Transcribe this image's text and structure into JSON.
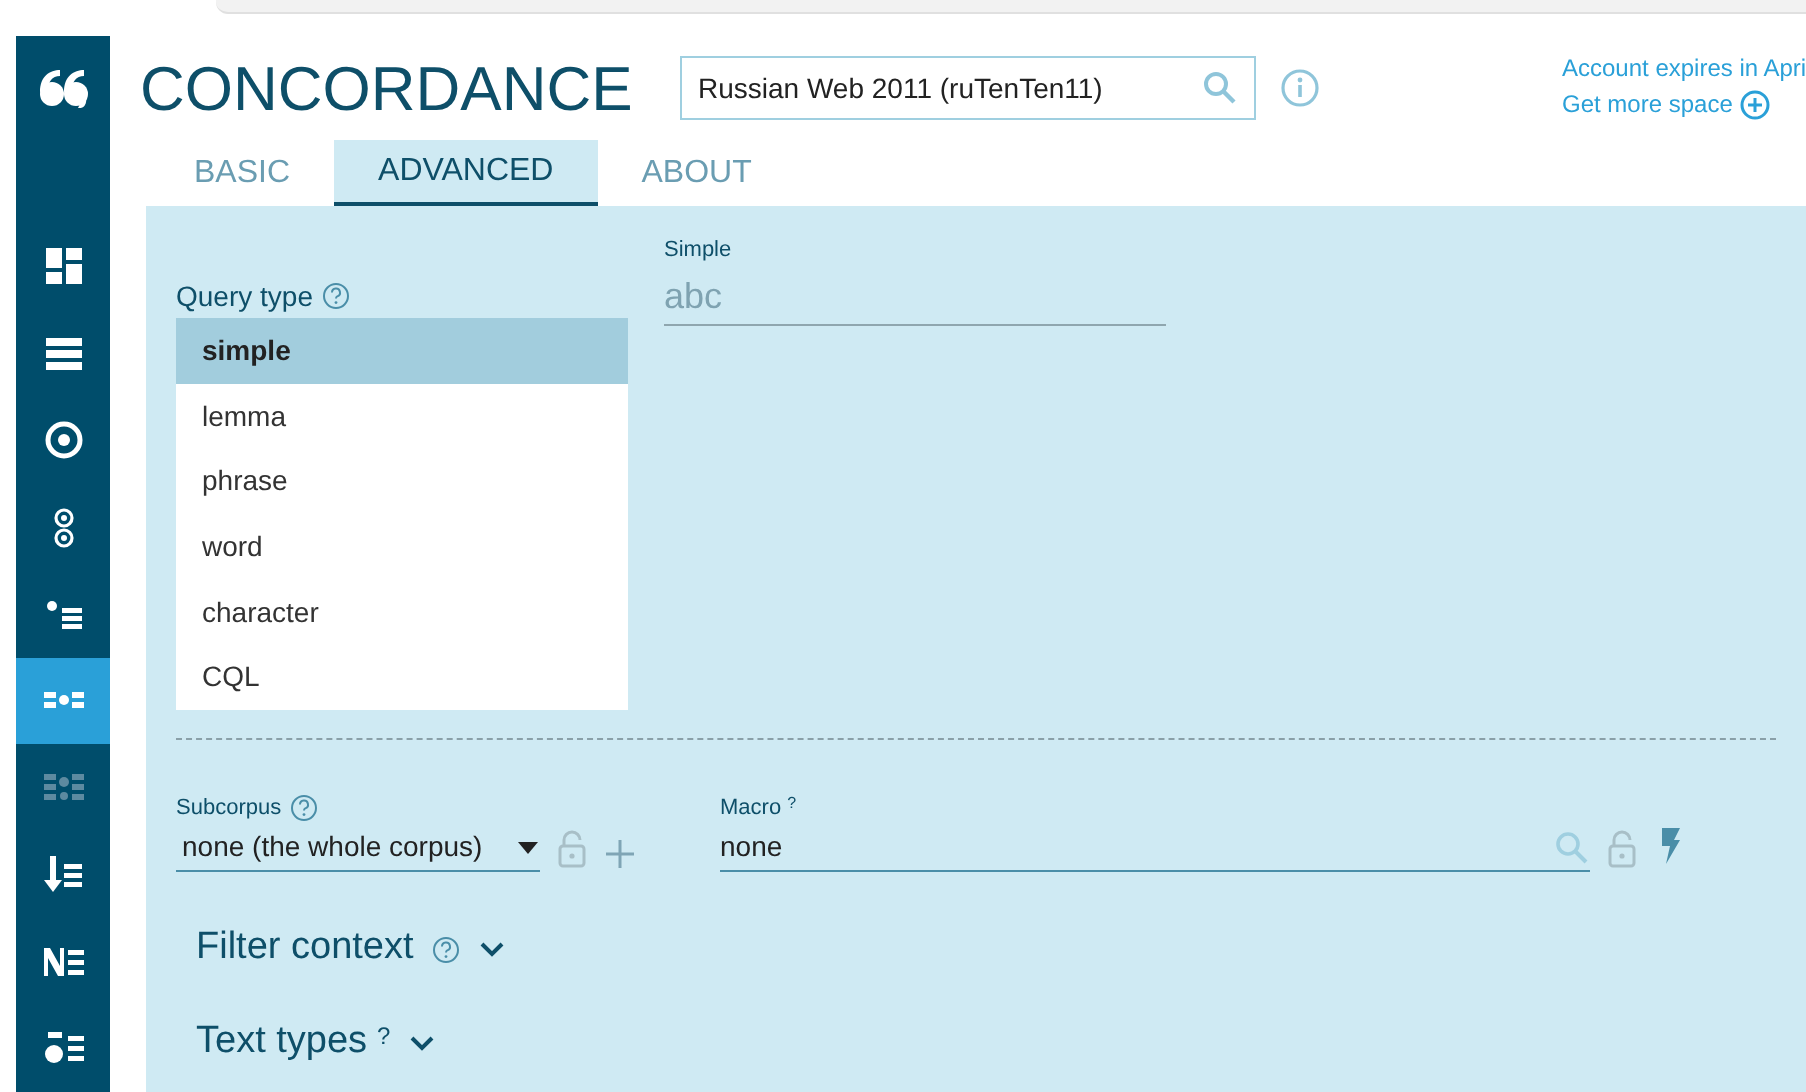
{
  "sidebar": {
    "items": [
      {
        "kind": "dashboard",
        "selected": false,
        "disabled": false
      },
      {
        "kind": "list",
        "selected": false,
        "disabled": false
      },
      {
        "kind": "target",
        "selected": false,
        "disabled": false
      },
      {
        "kind": "rings",
        "selected": false,
        "disabled": false
      },
      {
        "kind": "bullets",
        "selected": false,
        "disabled": false
      },
      {
        "kind": "dots",
        "selected": true,
        "disabled": false
      },
      {
        "kind": "dots-double",
        "selected": false,
        "disabled": true
      },
      {
        "kind": "sort",
        "selected": false,
        "disabled": false
      },
      {
        "kind": "ner",
        "selected": false,
        "disabled": false
      },
      {
        "kind": "stats",
        "selected": false,
        "disabled": false
      }
    ]
  },
  "header": {
    "title": "CONCORDANCE",
    "corpus": "Russian Web 2011 (ruTenTen11)",
    "account": "Account expires in Apri",
    "more_space": "Get more space"
  },
  "tabs": [
    {
      "label": "BASIC",
      "selected": false
    },
    {
      "label": "ADVANCED",
      "selected": true
    },
    {
      "label": "ABOUT",
      "selected": false
    }
  ],
  "query_type": {
    "label": "Query type",
    "options": [
      {
        "label": "simple",
        "selected": true
      },
      {
        "label": "lemma",
        "selected": false
      },
      {
        "label": "phrase",
        "selected": false
      },
      {
        "label": "word",
        "selected": false
      },
      {
        "label": "character",
        "selected": false
      },
      {
        "label": "CQL",
        "selected": false
      }
    ]
  },
  "simple": {
    "label": "Simple",
    "placeholder": "abc"
  },
  "subcorpus": {
    "label": "Subcorpus",
    "value": "none (the whole corpus)"
  },
  "macro": {
    "label": "Macro",
    "help": "?",
    "value": "none"
  },
  "sections": [
    {
      "label": "Filter context",
      "help_icon": true,
      "expanded": false
    },
    {
      "label": "Text types",
      "help_icon": false,
      "help": "?",
      "expanded": false
    }
  ]
}
